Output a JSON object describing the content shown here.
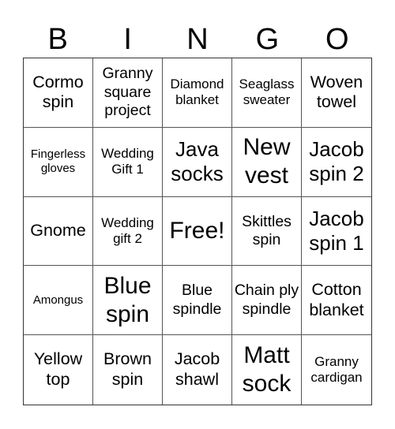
{
  "card": {
    "header": [
      "B",
      "I",
      "N",
      "G",
      "O"
    ],
    "cells": [
      {
        "text": "Cormo spin",
        "size": "big"
      },
      {
        "text": "Granny square project",
        "size": "med"
      },
      {
        "text": "Diamond blanket",
        "size": "small"
      },
      {
        "text": "Seaglass sweater",
        "size": "small"
      },
      {
        "text": "Woven towel",
        "size": "big"
      },
      {
        "text": "Fingerless gloves",
        "size": "xsmall"
      },
      {
        "text": "Wedding Gift 1",
        "size": "small"
      },
      {
        "text": "Java socks",
        "size": "large"
      },
      {
        "text": "New vest",
        "size": "xlarge"
      },
      {
        "text": "Jacob spin 2",
        "size": "large"
      },
      {
        "text": "Gnome",
        "size": "big"
      },
      {
        "text": "Wedding gift 2",
        "size": "small"
      },
      {
        "text": "Free!",
        "size": "xlarge"
      },
      {
        "text": "Skittles spin",
        "size": "med"
      },
      {
        "text": "Jacob spin 1",
        "size": "large"
      },
      {
        "text": "Amongus",
        "size": "xsmall"
      },
      {
        "text": "Blue spin",
        "size": "xlarge"
      },
      {
        "text": "Blue spindle",
        "size": "med"
      },
      {
        "text": "Chain ply spindle",
        "size": "med"
      },
      {
        "text": "Cotton blanket",
        "size": "big"
      },
      {
        "text": "Yellow top",
        "size": "big"
      },
      {
        "text": "Brown spin",
        "size": "big"
      },
      {
        "text": "Jacob shawl",
        "size": "big"
      },
      {
        "text": "Matt sock",
        "size": "xlarge"
      },
      {
        "text": "Granny cardigan",
        "size": "small"
      }
    ]
  }
}
